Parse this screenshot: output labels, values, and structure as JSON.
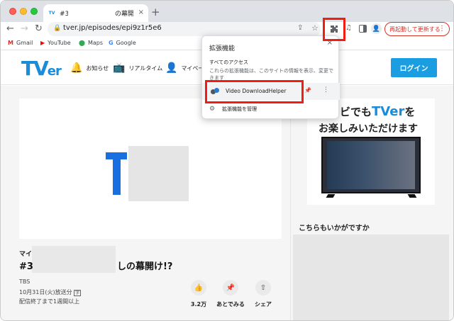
{
  "browser": {
    "tab_favicon": "TV",
    "tab_title_start": "#3",
    "tab_title_end": "の幕開け!",
    "tab_close": "×",
    "new_tab": "+",
    "url": "tver.jp/episodes/epi9z1r5e6",
    "relaunch_label": "再起動して更新する",
    "bookmarks": [
      {
        "label": "Gmail",
        "icon": "gmail-icon",
        "glyph": "M",
        "color": "#d93025"
      },
      {
        "label": "YouTube",
        "icon": "youtube-icon",
        "glyph": "▶",
        "color": "#ff0000"
      },
      {
        "label": "Maps",
        "icon": "maps-icon",
        "glyph": "⬤",
        "color": "#34a853"
      },
      {
        "label": "Google",
        "icon": "google-icon",
        "glyph": "G",
        "color": "#4285f4"
      }
    ]
  },
  "extensions_popup": {
    "title": "拡張機能",
    "access_heading": "すべてのアクセス",
    "access_desc": "これらの拡張機能は、このサイトの情報を表示、変更で",
    "access_desc2": "きます",
    "extension_name": "Video DownloadHelper",
    "manage_label": "拡張機能を管理"
  },
  "tver": {
    "logo_T": "TV",
    "logo_er": "er",
    "nav": [
      {
        "label": "お知らせ",
        "icon": "bell-icon",
        "glyph": "🔔"
      },
      {
        "label": "リアルタイム",
        "icon": "tv-icon",
        "glyph": "📺"
      },
      {
        "label": "マイページ",
        "icon": "user-icon",
        "glyph": "👤"
      }
    ],
    "login_label": "ログイン",
    "episode": {
      "series_prefix": "マイ",
      "title_start": "#3",
      "title_end": "しの幕開け!?",
      "channel": "TBS",
      "aired": "10月31日(火)放送分",
      "aired_badge": "字",
      "deadline": "配信終了まで1週間以上"
    },
    "actions": [
      {
        "label": "3.2万",
        "icon": "thumbs-up-icon",
        "glyph": "👍"
      },
      {
        "label": "あとでみる",
        "icon": "pin-icon",
        "glyph": "📌"
      },
      {
        "label": "シェア",
        "icon": "share-icon",
        "glyph": "⇧"
      }
    ],
    "ad": {
      "line1_a": "テレビでも",
      "line1_b": "TVer",
      "line1_c": "を",
      "line2": "お楽しみいただけます"
    },
    "recommend_title": "こちらもいかがですか"
  }
}
